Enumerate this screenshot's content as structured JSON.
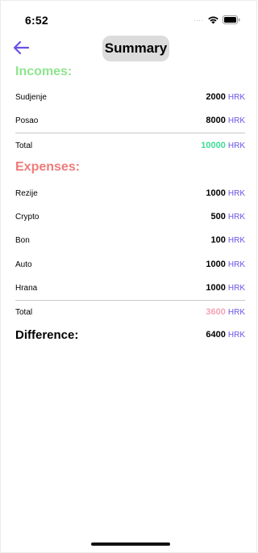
{
  "status_bar": {
    "time": "6:52",
    "signal": "....",
    "wifi_icon": "wifi-icon",
    "battery_icon": "battery-icon"
  },
  "nav": {
    "back_icon": "arrow-left-icon",
    "title": "Summary"
  },
  "incomes": {
    "title": "Incomes:",
    "color": "#8ee58e",
    "items": [
      {
        "label": "Sudjenje",
        "amount": "2000",
        "currency": "HRK"
      },
      {
        "label": "Posao",
        "amount": "8000",
        "currency": "HRK"
      }
    ],
    "total": {
      "label": "Total",
      "amount": "10000",
      "currency": "HRK",
      "color": "#3ddc97"
    }
  },
  "expenses": {
    "title": "Expenses:",
    "color": "#ef7b7b",
    "items": [
      {
        "label": "Rezije",
        "amount": "1000",
        "currency": "HRK"
      },
      {
        "label": "Crypto",
        "amount": "500",
        "currency": "HRK"
      },
      {
        "label": "Bon",
        "amount": "100",
        "currency": "HRK"
      },
      {
        "label": "Auto",
        "amount": "1000",
        "currency": "HRK"
      },
      {
        "label": "Hrana",
        "amount": "1000",
        "currency": "HRK"
      }
    ],
    "total": {
      "label": "Total",
      "amount": "3600",
      "currency": "HRK",
      "color": "#f4a3b4"
    }
  },
  "difference": {
    "label": "Difference:",
    "amount": "6400",
    "currency": "HRK"
  },
  "colors": {
    "accent": "#6a52e6",
    "title_pill": "#dcdcdc"
  }
}
